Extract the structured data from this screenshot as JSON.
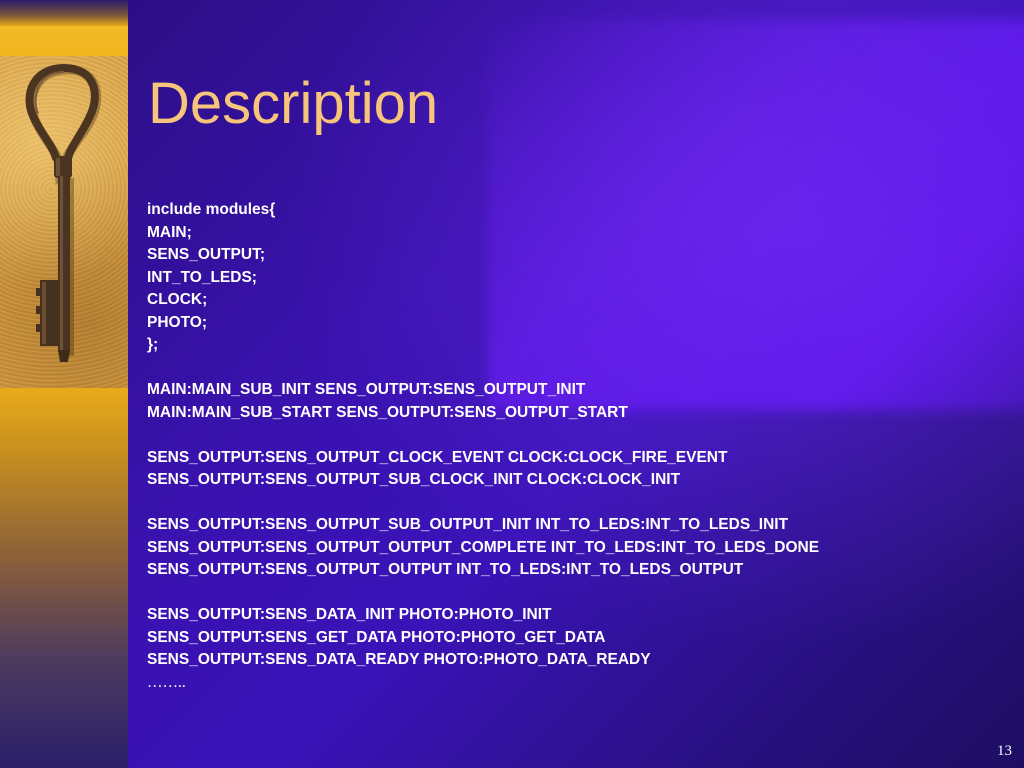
{
  "slide": {
    "title": "Description",
    "lines": [
      "include modules{",
      "MAIN;",
      "SENS_OUTPUT;",
      "INT_TO_LEDS;",
      "CLOCK;",
      "PHOTO;",
      "};",
      "",
      "MAIN:MAIN_SUB_INIT SENS_OUTPUT:SENS_OUTPUT_INIT",
      "MAIN:MAIN_SUB_START SENS_OUTPUT:SENS_OUTPUT_START",
      "",
      "SENS_OUTPUT:SENS_OUTPUT_CLOCK_EVENT CLOCK:CLOCK_FIRE_EVENT",
      "SENS_OUTPUT:SENS_OUTPUT_SUB_CLOCK_INIT CLOCK:CLOCK_INIT",
      "",
      "SENS_OUTPUT:SENS_OUTPUT_SUB_OUTPUT_INIT INT_TO_LEDS:INT_TO_LEDS_INIT",
      "SENS_OUTPUT:SENS_OUTPUT_OUTPUT_COMPLETE INT_TO_LEDS:INT_TO_LEDS_DONE",
      "SENS_OUTPUT:SENS_OUTPUT_OUTPUT INT_TO_LEDS:INT_TO_LEDS_OUTPUT",
      "",
      "SENS_OUTPUT:SENS_DATA_INIT PHOTO:PHOTO_INIT",
      "SENS_OUTPUT:SENS_GET_DATA PHOTO:PHOTO_GET_DATA",
      "SENS_OUTPUT:SENS_DATA_READY PHOTO:PHOTO_DATA_READY",
      "……..",
      ""
    ],
    "page_number": "13"
  },
  "colors": {
    "title": "#f6c47a",
    "body_text": "#ffffff",
    "panel": "#3a12b0",
    "band": "#f0b51f"
  },
  "icons": {
    "decoration": "key-icon"
  }
}
